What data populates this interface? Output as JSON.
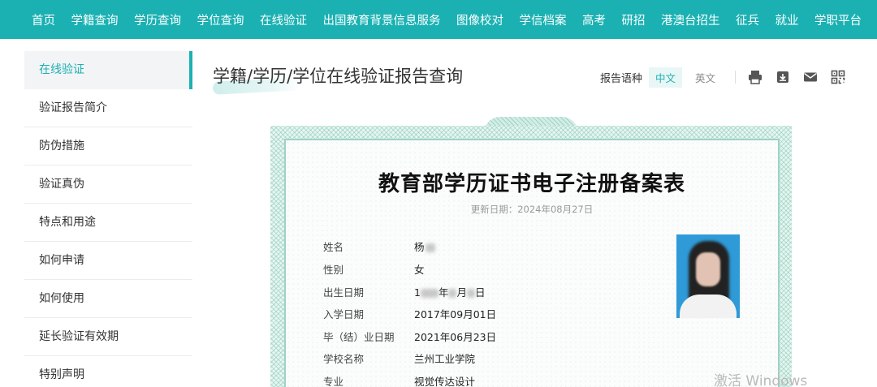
{
  "nav": {
    "items": [
      "首页",
      "学籍查询",
      "学历查询",
      "学位查询",
      "在线验证",
      "出国教育背景信息服务",
      "图像校对",
      "学信档案",
      "高考",
      "研招",
      "港澳台招生",
      "征兵",
      "就业",
      "学职平台"
    ]
  },
  "sidebar": {
    "items": [
      "在线验证",
      "验证报告简介",
      "防伪措施",
      "验证真伪",
      "特点和用途",
      "如何申请",
      "如何使用",
      "延长验证有效期",
      "特别声明"
    ],
    "active_index": 0
  },
  "header": {
    "title": "学籍/学历/学位在线验证报告查询",
    "lang_label": "报告语种",
    "lang_zh": "中文",
    "lang_en": "英文"
  },
  "icons": {
    "print": "print-icon",
    "download": "download-icon",
    "mail": "mail-icon",
    "qr": "qr-code-icon"
  },
  "certificate": {
    "title": "教育部学历证书电子注册备案表",
    "update_date": "更新日期：2024年08月27日",
    "fields": {
      "name_label": "姓名",
      "name_value": "杨",
      "gender_label": "性别",
      "gender_value": "女",
      "birth_label": "出生日期",
      "birth_v1": "1",
      "birth_v2": "年",
      "birth_v3": "月",
      "birth_v4": "日",
      "enroll_label": "入学日期",
      "enroll_value": "2017年09月01日",
      "grad_label": "毕（结）业日期",
      "grad_value": "2021年06月23日",
      "school_label": "学校名称",
      "school_value": "兰州工业学院",
      "major_label": "专业",
      "major_value": "视觉传达设计"
    }
  },
  "watermark": "激活 Windows",
  "colors": {
    "accent": "#1bb1b3",
    "cert_border": "#9fd2c4"
  }
}
